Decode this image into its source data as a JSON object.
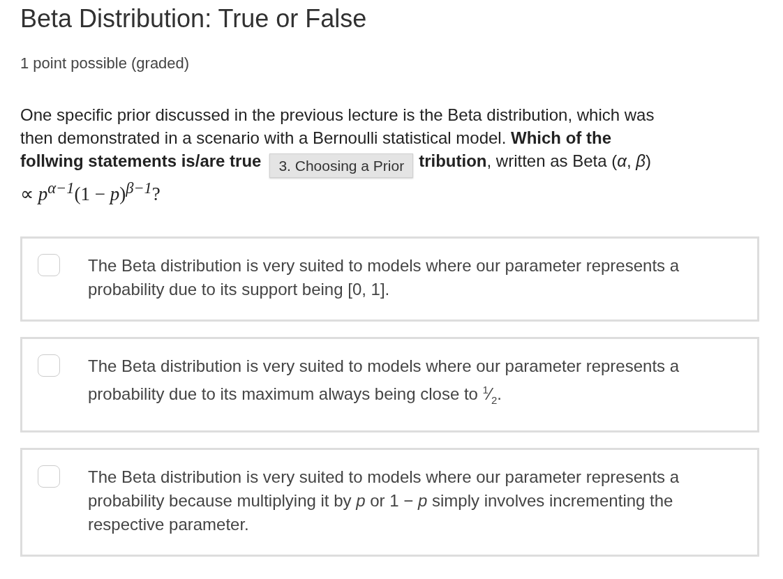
{
  "title": "Beta Distribution: True or False",
  "points": "1 point possible (graded)",
  "prompt": {
    "lines": [
      "One specific prior discussed in the previous lecture is the Beta distribution, which was",
      "then demonstrated in a scenario with a Bernoulli statistical model. **Which of the**"
    ],
    "before_tooltip": "**follwing statements is/are true**",
    "after_tooltip": "**tribution**, written as Beta (*α*, *β*)",
    "formula": "∝ *p*$^{α−1}$(1 − *p*)$^{β−1}$?"
  },
  "tooltip": "3. Choosing a Prior",
  "options": [
    {
      "text": "The Beta distribution is very suited to models where our parameter represents a probability due to its support being [0, 1].",
      "checked": false
    },
    {
      "text": "The Beta distribution is very suited to models where our parameter represents a probability due to its maximum always being close to $^{1}$⁄$_{2}$.",
      "checked": false
    },
    {
      "text": "The Beta distribution is very suited to models where our parameter represents a probability because multiplying it by *p* or 1 − *p* simply involves incrementing the respective parameter.",
      "checked": false
    }
  ]
}
